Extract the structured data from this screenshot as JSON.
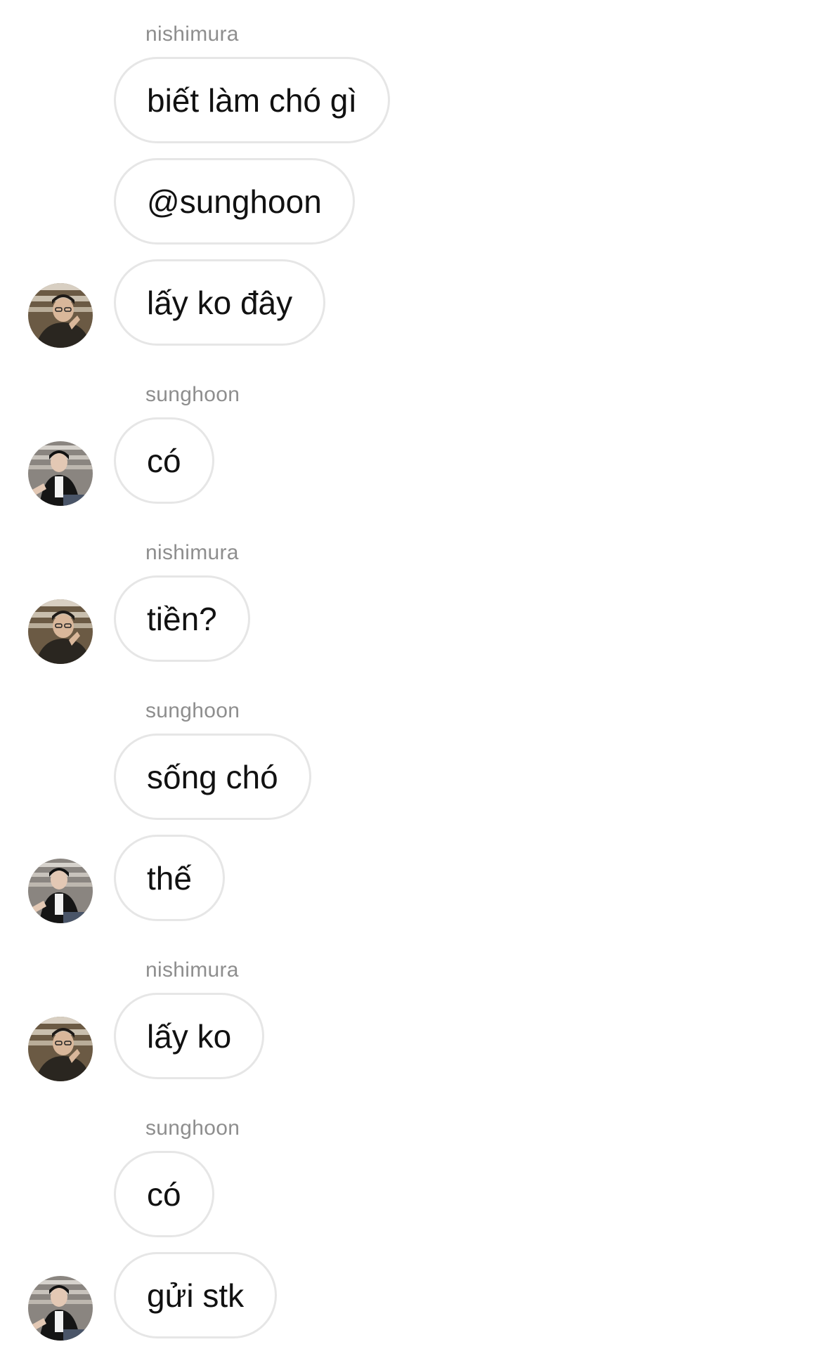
{
  "senders": {
    "nishimura": "nishimura",
    "sunghoon": "sunghoon"
  },
  "messages": [
    {
      "sender": "nishimura",
      "text": "biết làm chó gì"
    },
    {
      "sender": "nishimura",
      "text": "@sunghoon"
    },
    {
      "sender": "nishimura",
      "text": "lấy ko đây"
    },
    {
      "sender": "sunghoon",
      "text": "có"
    },
    {
      "sender": "nishimura",
      "text": "tiền?"
    },
    {
      "sender": "sunghoon",
      "text": "sống chó"
    },
    {
      "sender": "sunghoon",
      "text": "thế"
    },
    {
      "sender": "nishimura",
      "text": "lấy ko"
    },
    {
      "sender": "sunghoon",
      "text": "có"
    },
    {
      "sender": "sunghoon",
      "text": "gửi stk"
    }
  ],
  "colors": {
    "sender_label": "#8e8e8e",
    "bubble_border": "#e6e6e6",
    "text": "#111111",
    "background": "#ffffff"
  },
  "icons": {
    "avatar_nishimura": "avatar-photo",
    "avatar_sunghoon": "avatar-photo"
  }
}
